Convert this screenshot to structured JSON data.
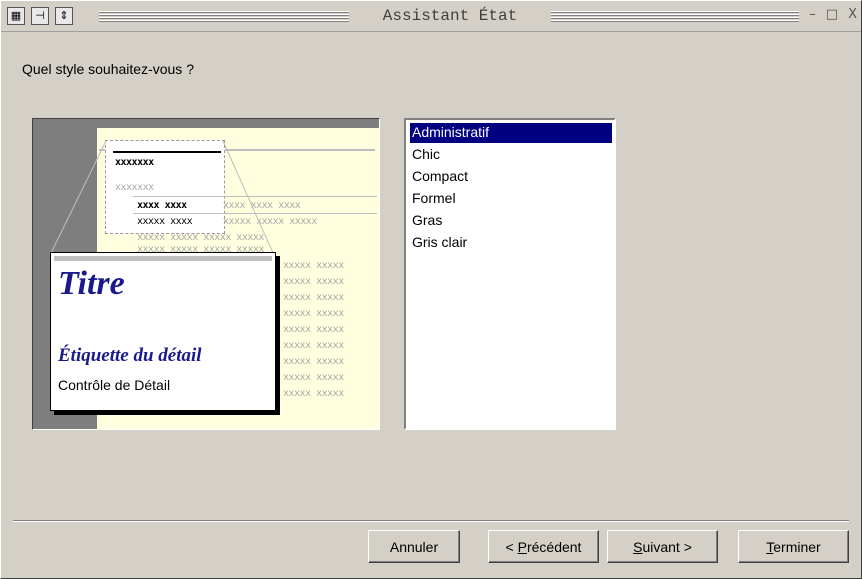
{
  "window": {
    "title": "Assistant État",
    "controls": {
      "minimize": "–",
      "maximize": "□",
      "close": "X"
    }
  },
  "question": "Quel style souhaitez-vous ?",
  "preview": {
    "placeholder_bold_1": "xxxxxxx",
    "placeholder_light": "xxxxxxx",
    "placeholder_bold_2": "xxxx xxxx",
    "placeholder_grey_2": "xxxx xxxx xxxx",
    "placeholder_bold_3": "xxxxx xxxx",
    "placeholder_grey_3": "xxxxx xxxxx xxxxx",
    "placeholder_row": "xxxxx xxxxx xxxxx xxxxx",
    "placeholder_row_right": "xxxxx xxxxx",
    "zoom": {
      "title": "Titre",
      "detail_label": "Étiquette du détail",
      "detail_control": "Contrôle de Détail"
    }
  },
  "styles": {
    "items": [
      "Administratif",
      "Chic",
      "Compact",
      "Formel",
      "Gras",
      "Gris clair"
    ],
    "selected_index": 0
  },
  "buttons": {
    "cancel": "Annuler",
    "previous_prefix": "< ",
    "previous_mnemonic": "P",
    "previous_rest": "récédent",
    "next_mnemonic": "S",
    "next_rest": "uivant >",
    "finish_mnemonic": "T",
    "finish_rest": "erminer"
  }
}
